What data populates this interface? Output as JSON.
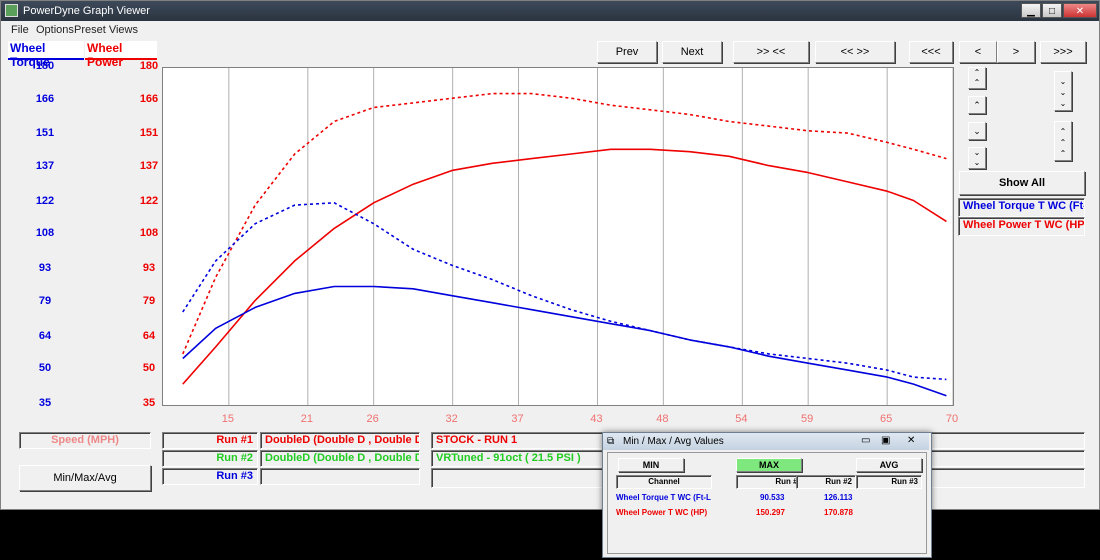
{
  "window": {
    "title": "PowerDyne Graph Viewer"
  },
  "menu": [
    "File",
    "Options",
    "Preset Views"
  ],
  "legend_tabs": {
    "torque": "Wheel Torque",
    "power": "Wheel Power"
  },
  "colors": {
    "torque": "#0000dd",
    "power": "#ee0000",
    "green": "#22cc22",
    "grid": "#b0b0b0"
  },
  "nav": {
    "prev": "Prev",
    "next": "Next",
    "b3": ">> <<",
    "b4": "<< >>",
    "b5": "<<<",
    "b6": "<",
    "b7": ">",
    "b8": ">>>"
  },
  "right_panel": {
    "show_all": "Show All",
    "ch1": "Wheel Torque T WC (Ft-L",
    "ch2": "Wheel Power T WC (HP)"
  },
  "runs": {
    "r1": {
      "label": "Run #1",
      "car": "DoubleD (Double D , Double D )",
      "desc": "STOCK - RUN 1"
    },
    "r2": {
      "label": "Run #2",
      "car": "DoubleD (Double D , Double D )",
      "desc": "VRTuned - 91oct ( 21.5 PSI )"
    },
    "r3": {
      "label": "Run #3"
    }
  },
  "bottom": {
    "speed": "Speed (MPH)",
    "minmax_btn": "Min/Max/Avg"
  },
  "minmax": {
    "title": "Min / Max / Avg Values",
    "min": "MIN",
    "max": "MAX",
    "avg": "AVG",
    "headers": [
      "Channel",
      "Run #1",
      "Run #2",
      "Run #3"
    ],
    "rows": [
      {
        "channel": "Wheel Torque T WC (Ft-L",
        "r1": "90.533",
        "r2": "126.113",
        "r3": ""
      },
      {
        "channel": "Wheel Power T WC (HP)",
        "r1": "150.297",
        "r2": "170.878",
        "r3": ""
      }
    ]
  },
  "chart_data": {
    "type": "line",
    "xlim": [
      10,
      70
    ],
    "ylim": [
      35,
      180
    ],
    "x_ticks": [
      15,
      21,
      26,
      32,
      37,
      43,
      48,
      54,
      59,
      65,
      70
    ],
    "y_ticks_torque": [
      180,
      166,
      151,
      137,
      122,
      108,
      93,
      79,
      64,
      50,
      35
    ],
    "y_ticks_power": [
      180,
      166,
      151,
      137,
      122,
      108,
      93,
      79,
      64,
      50,
      35
    ],
    "grid": true,
    "series": [
      {
        "name": "Wheel Power T WC (HP)",
        "run": "Run #1",
        "color": "#ee0000",
        "dash": false,
        "x": [
          11.5,
          14,
          17,
          20,
          23,
          26,
          29,
          32,
          35,
          38,
          41,
          44,
          47,
          50,
          53,
          56,
          59,
          62,
          65,
          67,
          69.5
        ],
        "y": [
          44,
          60,
          80,
          97,
          111,
          122,
          130,
          136,
          139,
          141,
          143,
          145,
          145,
          144,
          142,
          138,
          135,
          131,
          127,
          123,
          114
        ]
      },
      {
        "name": "Wheel Power T WC (HP)",
        "run": "Run #2",
        "color": "#ee0000",
        "dash": true,
        "x": [
          11.5,
          14,
          17,
          20,
          23,
          26,
          29,
          32,
          35,
          38,
          41,
          44,
          47,
          50,
          53,
          56,
          59,
          62,
          65,
          67,
          69.5
        ],
        "y": [
          57,
          90,
          121,
          143,
          157,
          163,
          165,
          167,
          169,
          169,
          167,
          164,
          162,
          160,
          157,
          155,
          153,
          152,
          148,
          145,
          141
        ]
      },
      {
        "name": "Wheel Torque T WC (Ft-L",
        "run": "Run #1",
        "color": "#0000dd",
        "dash": false,
        "x": [
          11.5,
          14,
          17,
          20,
          23,
          26,
          29,
          32,
          35,
          38,
          41,
          44,
          47,
          50,
          53,
          56,
          59,
          62,
          65,
          67,
          69.5
        ],
        "y": [
          55,
          68,
          77,
          83,
          86,
          86,
          85,
          82,
          79,
          76,
          73,
          70,
          67,
          63,
          60,
          56,
          53,
          50,
          47,
          44,
          39
        ]
      },
      {
        "name": "Wheel Torque T WC (Ft-L",
        "run": "Run #2",
        "color": "#0000dd",
        "dash": true,
        "x": [
          11.5,
          14,
          17,
          20,
          23,
          26,
          29,
          32,
          35,
          38,
          41,
          44,
          47,
          50,
          53,
          56,
          59,
          62,
          65,
          67,
          69.5
        ],
        "y": [
          75,
          97,
          113,
          121,
          122,
          113,
          102,
          95,
          89,
          82,
          76,
          71,
          67,
          63,
          60,
          57,
          55,
          53,
          50,
          47,
          46
        ]
      }
    ]
  }
}
